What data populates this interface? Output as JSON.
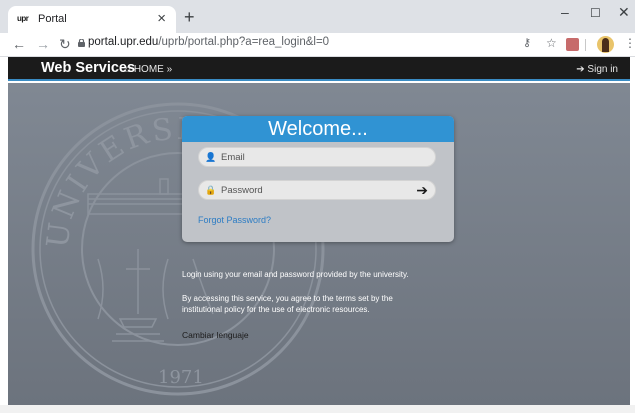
{
  "browser": {
    "tab_title": "Portal",
    "tab_favicon": "upr",
    "new_tab": "+",
    "url_host": "portal.upr.edu",
    "url_path": "/uprb/portal.php?a=rea_login&l=0",
    "window_controls": {
      "minimize": "–",
      "maximize": "☐",
      "close": "✕"
    }
  },
  "navbar": {
    "brand": "Web Services",
    "home_label": "HOME »",
    "signin_label": "Sign in"
  },
  "seal": {
    "university_text": "UNIVERSIDAD DE PUERTO RICO",
    "year": "1971"
  },
  "login": {
    "title": "Welcome...",
    "email_placeholder": "Email",
    "password_placeholder": "Password",
    "forgot_link": "Forgot Password?"
  },
  "info": {
    "line1": "Login using your email and password provided by the university.",
    "line2a": "By accessing this service, you agree to the terms set by the",
    "line2b": "institutional policy for the use of electronic resources.",
    "language_link": "Cambiar lenguaje"
  },
  "icons": {
    "tab_close": "close-icon",
    "back": "back-arrow-icon",
    "forward": "forward-arrow-icon",
    "reload": "reload-icon",
    "lock": "lock-icon",
    "key": "key-icon",
    "star": "star-icon",
    "pdf": "pdf-extension-icon",
    "menu": "kebab-menu-icon",
    "home": "home-icon",
    "signin": "sign-in-icon",
    "user": "user-icon",
    "password_lock": "lock-icon",
    "submit": "sign-in-arrow-icon"
  },
  "colors": {
    "navbar": "#1b1b1b",
    "card_header": "#3093d3",
    "page_background": "#7a818b",
    "link": "#2c7cc4"
  }
}
